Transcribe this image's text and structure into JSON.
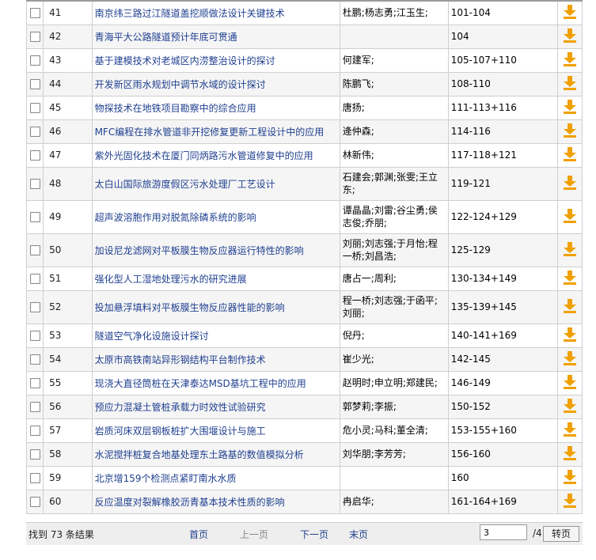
{
  "rows": [
    {
      "num": "41",
      "title": "南京纬三路过江隧道盖挖顺做法设计关键技术",
      "author": "杜鹏;杨志勇;江玉生;",
      "pages": "101-104"
    },
    {
      "num": "42",
      "title": "青海平大公路隧道预计年底可贯通",
      "author": "",
      "pages": "104"
    },
    {
      "num": "43",
      "title": "基于建模技术对老城区内涝整治设计的探讨",
      "author": "何建军;",
      "pages": "105-107+110"
    },
    {
      "num": "44",
      "title": "开发新区雨水规划中调节水域的设计探讨",
      "author": "陈鹏飞;",
      "pages": "108-110"
    },
    {
      "num": "45",
      "title": "物探技术在地铁项目勘察中的综合应用",
      "author": "唐扬;",
      "pages": "111-113+116"
    },
    {
      "num": "46",
      "title": "MFC编程在排水管道非开挖修复更新工程设计中的应用",
      "author": "逄仲森;",
      "pages": "114-116"
    },
    {
      "num": "47",
      "title": "紫外光固化技术在厦门同炳路污水管道修复中的应用",
      "author": "林新伟;",
      "pages": "117-118+121"
    },
    {
      "num": "48",
      "title": "太白山国际旅游度假区污水处理厂工艺设计",
      "author": "石建会;郭渊;张雯;王立东;",
      "pages": "119-121"
    },
    {
      "num": "49",
      "title": "超声波溶胞作用对脱氮除磷系统的影响",
      "author": "谭晶晶;刘雷;谷尘勇;侯志俊;乔朋;",
      "pages": "122-124+129"
    },
    {
      "num": "50",
      "title": "加设尼龙滤网对平板膜生物反应器运行特性的影响",
      "author": "刘丽;刘志强;于月怡;程一桥;刘昌浩;",
      "pages": "125-129"
    },
    {
      "num": "51",
      "title": "强化型人工湿地处理污水的研究进展",
      "author": "唐占一;周利;",
      "pages": "130-134+149"
    },
    {
      "num": "52",
      "title": "投加悬浮填料对平板膜生物反应器性能的影响",
      "author": "程一桥;刘志强;于函平;刘丽;",
      "pages": "135-139+145"
    },
    {
      "num": "53",
      "title": "隧道空气净化设施设计探讨",
      "author": "倪丹;",
      "pages": "140-141+169"
    },
    {
      "num": "54",
      "title": "太原市高铁南站异形钢结构平台制作技术",
      "author": "崔少光;",
      "pages": "142-145"
    },
    {
      "num": "55",
      "title": "现浇大直径筒桩在天津泰达MSD基坑工程中的应用",
      "author": "赵明时;申立明;郑建民;",
      "pages": "146-149"
    },
    {
      "num": "56",
      "title": "预应力混凝土管桩承载力时效性试验研究",
      "author": "郭梦莉;李振;",
      "pages": "150-152"
    },
    {
      "num": "57",
      "title": "岩质河床双层钢板桩扩大围堰设计与施工",
      "author": "危小灵;马科;董全清;",
      "pages": "153-155+160"
    },
    {
      "num": "58",
      "title": "水泥搅拌桩复合地基处理东土路基的数值模拟分析",
      "author": "刘华朋;李芳芳;",
      "pages": "156-160"
    },
    {
      "num": "59",
      "title": "北京增159个检测点紧盯南水水质",
      "author": "",
      "pages": "160"
    },
    {
      "num": "60",
      "title": "反应温度对裂解橡胶沥青基本技术性质的影响",
      "author": "冉启华;",
      "pages": "161-164+169"
    }
  ],
  "footer": {
    "found": "找到 73 条结果",
    "first": "首页",
    "prev": "上一页",
    "next": "下一页",
    "last": "末页",
    "page_value": "3",
    "total": "/4",
    "go": "转页"
  },
  "icons": {
    "download": "download-arrow-icon",
    "download_color": "#f0a000"
  }
}
